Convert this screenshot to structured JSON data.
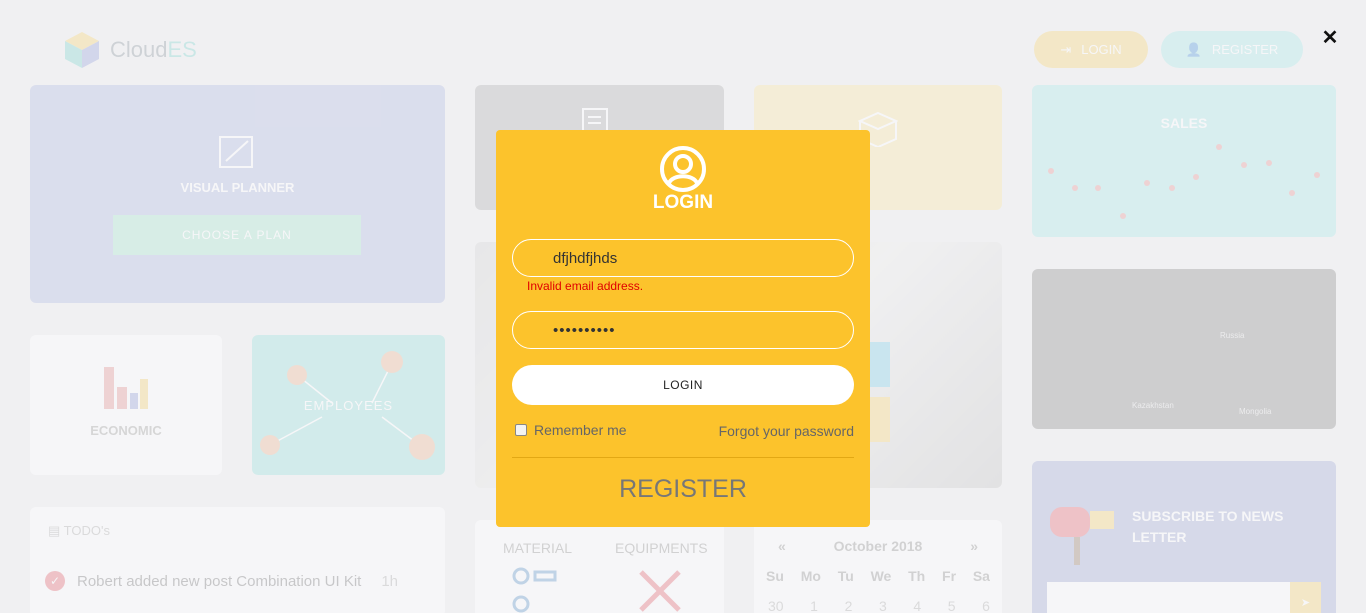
{
  "app": {
    "logo_text": "Cloud",
    "logo_accent": "ES",
    "header": {
      "login_label": "LOGIN",
      "register_label": "REGISTER"
    }
  },
  "dashboard": {
    "visual_planner": {
      "title": "VISUAL PLANNER",
      "button": "CHOOSE A PLAN"
    },
    "economic": {
      "title": "ECONOMIC"
    },
    "employees": {
      "title": "EMPLOYEES"
    },
    "todo": {
      "title": "TODO's",
      "item_text": "Robert added new post Combination UI Kit",
      "item_time": "1h"
    },
    "material": {
      "left": "MATERIAL",
      "right": "EQUIPMENTS"
    },
    "calendar": {
      "prev": "«",
      "month": "October 2018",
      "next": "»",
      "days": [
        "Su",
        "Mo",
        "Tu",
        "We",
        "Th",
        "Fr",
        "Sa"
      ],
      "first_row": [
        "30",
        "1",
        "2",
        "3",
        "4",
        "5",
        "6"
      ]
    },
    "sales": {
      "title": "SALES"
    },
    "map": {
      "labels": [
        "Kazakhstan",
        "Mongolia",
        "Russia"
      ]
    },
    "newsletter": {
      "title": "SUBSCRIBE TO NEWS LETTER"
    }
  },
  "close_icon": "close-icon",
  "login_modal": {
    "title": "LOGIN",
    "email_value": "dfjhdfjhds",
    "email_error": "Invalid email address.",
    "password_value": "••••••••••",
    "login_button": "LOGIN",
    "remember_label": "Remember me",
    "remember_checked": false,
    "forgot_label": "Forgot your password",
    "register_label": "REGISTER"
  },
  "colors": {
    "modal_bg": "#fcc32c",
    "error": "#e00000",
    "accent_teal": "#5ec8c1"
  }
}
